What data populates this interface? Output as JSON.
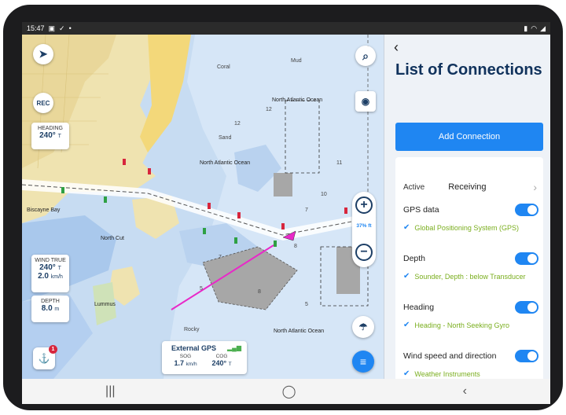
{
  "status_bar": {
    "time": "15:47",
    "left_icons": [
      "image-icon",
      "check-icon",
      "dot-icon"
    ],
    "right_icons": [
      "battery-icon",
      "wifi-icon",
      "signal-icon"
    ]
  },
  "map": {
    "heading": {
      "label": "HEADING",
      "value": "240°",
      "unit": "T"
    },
    "wind": {
      "label": "WIND TRUE",
      "angle": "240°",
      "angle_unit": "T",
      "speed": "2.0",
      "speed_unit": "km/h"
    },
    "depth": {
      "label": "DEPTH",
      "value": "8.0",
      "unit": "m"
    },
    "external_gps": {
      "title": "External GPS",
      "sog_label": "SOG",
      "cog_label": "COG",
      "sog_value": "1.7",
      "sog_unit": "km/h",
      "cog_value": "240°",
      "cog_unit": "T"
    },
    "rec_label": "REC",
    "zoom_scale": "37% ft",
    "alert_badge": "1",
    "place_labels": [
      "North Atlantic Ocean",
      "North Atlantic Ocean",
      "North Atlantic Ocean",
      "Biscayne Bay",
      "North Cut",
      "Lummus",
      "Sand",
      "Coral",
      "Rocky",
      "Mud"
    ],
    "depth_soundings": [
      "8",
      "8",
      "10",
      "12",
      "12",
      "11",
      "7",
      "7",
      "5",
      "5"
    ]
  },
  "panel": {
    "title": "List of Connections",
    "add_button": "Add Connection",
    "active": {
      "label": "Active",
      "status": "Receiving"
    },
    "connections": [
      {
        "name": "GPS data",
        "detail": "Global Positioning System (GPS)",
        "enabled": true
      },
      {
        "name": "Depth",
        "detail": "Sounder, Depth : below Transducer",
        "enabled": true
      },
      {
        "name": "Heading",
        "detail": "Heading - North Seeking Gyro",
        "enabled": true
      },
      {
        "name": "Wind speed and direction",
        "detail": "Weather Instruments",
        "enabled": true
      }
    ]
  },
  "colors": {
    "accent": "#1f86f2",
    "title": "#10325c",
    "detail": "#7aae1e",
    "water": "#c7dcf2",
    "land": "#efe3b0",
    "track": "#e829c8"
  }
}
